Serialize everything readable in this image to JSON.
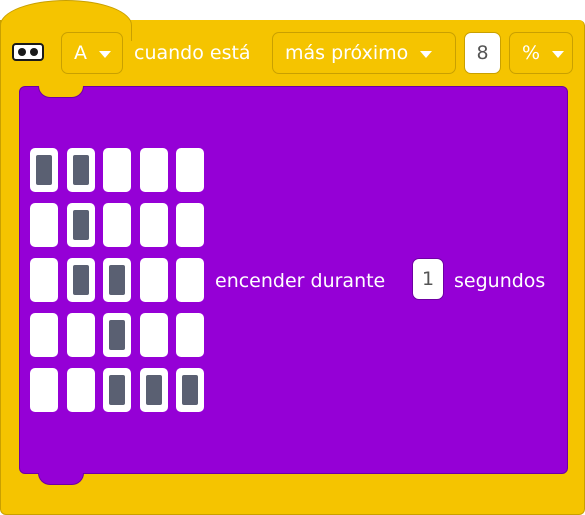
{
  "header": {
    "sensor_icon": "distance-sensor-icon",
    "port": "A",
    "when_label": "cuando está",
    "condition": "más próximo",
    "threshold": "8",
    "unit": "%"
  },
  "action": {
    "matrix": [
      [
        1,
        1,
        0,
        0,
        0
      ],
      [
        0,
        1,
        0,
        0,
        0
      ],
      [
        0,
        1,
        1,
        0,
        0
      ],
      [
        0,
        0,
        1,
        0,
        0
      ],
      [
        0,
        0,
        1,
        1,
        1
      ]
    ],
    "turn_on_label": "encender durante",
    "duration": "1",
    "seconds_label": "segundos"
  },
  "colors": {
    "event_block": "#f5c400",
    "light_block": "#9500d6",
    "pixel_on": "#5a6072",
    "pixel_off": "#ffffff"
  }
}
